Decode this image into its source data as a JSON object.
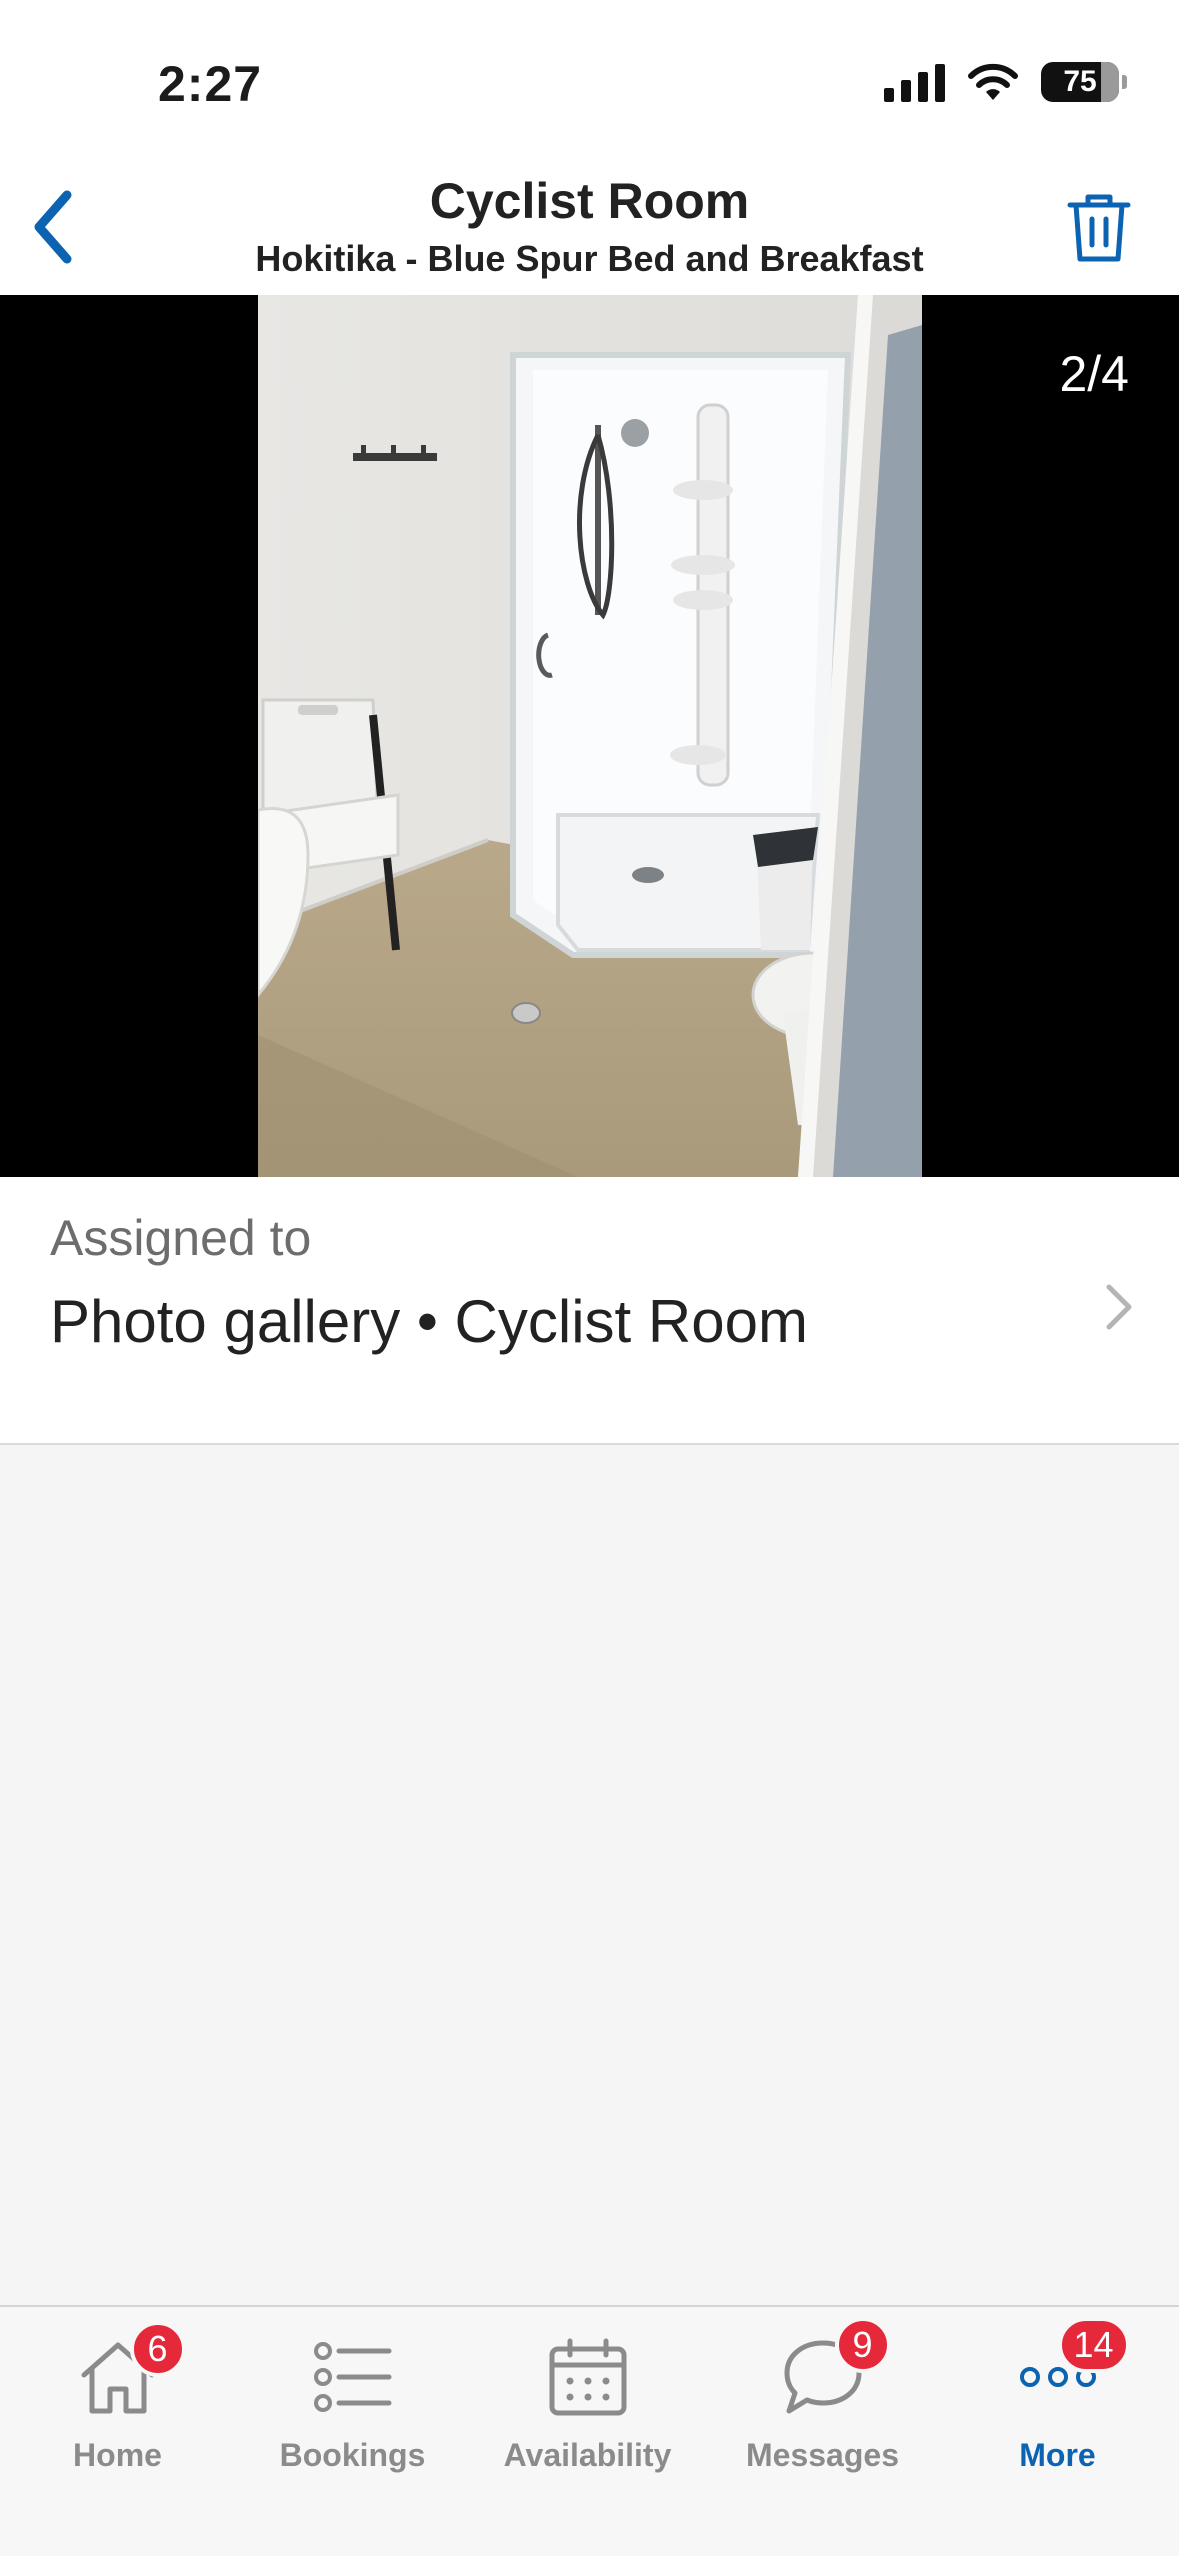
{
  "status_bar": {
    "time": "2:27",
    "battery": "75"
  },
  "header": {
    "title": "Cyclist Room",
    "subtitle": "Hokitika - Blue Spur Bed and Breakfast",
    "back_icon": "chevron-left-icon",
    "delete_icon": "trash-icon",
    "accent_color": "#0b63b2"
  },
  "photo": {
    "counter": "2/4",
    "current": 2,
    "total": 4
  },
  "assigned": {
    "caption": "Assigned to",
    "value": "Photo gallery • Cyclist Room"
  },
  "tabs": [
    {
      "label": "Home",
      "icon": "home-icon",
      "badge": "6",
      "active": false
    },
    {
      "label": "Bookings",
      "icon": "list-icon",
      "badge": null,
      "active": false
    },
    {
      "label": "Availability",
      "icon": "calendar-icon",
      "badge": null,
      "active": false
    },
    {
      "label": "Messages",
      "icon": "chat-bubble-icon",
      "badge": "9",
      "active": false
    },
    {
      "label": "More",
      "icon": "more-dots-icon",
      "badge": "14",
      "active": true
    }
  ]
}
